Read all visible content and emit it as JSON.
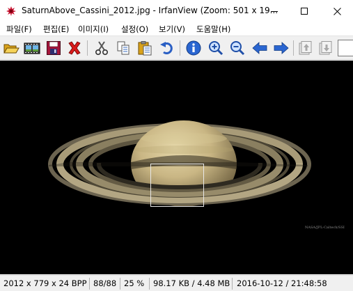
{
  "window": {
    "title": "SaturnAbove_Cassini_2012.jpg - IrfanView (Zoom: 501 x 19..."
  },
  "menu": [
    {
      "label": "파일(F)"
    },
    {
      "label": "편집(E)"
    },
    {
      "label": "이미지(I)"
    },
    {
      "label": "설정(O)"
    },
    {
      "label": "보기(V)"
    },
    {
      "label": "도움말(H)"
    }
  ],
  "toolbar": {
    "buttons": [
      "open-folder-icon",
      "slideshow-icon",
      "save-icon",
      "delete-icon",
      "cut-icon",
      "copy-icon",
      "paste-icon",
      "undo-icon",
      "info-icon",
      "zoom-in-icon",
      "zoom-out-icon",
      "previous-icon",
      "next-icon",
      "first-page-icon",
      "last-page-icon"
    ]
  },
  "image": {
    "credit": "NASA/JPL-Caltech/SSI"
  },
  "status": {
    "dimensions": "2012 x 779 x 24 BPP",
    "index": "88/88",
    "zoom": "25 %",
    "filesize": "98.17 KB / 4.48 MB",
    "datetime": "2016-10-12 / 21:48:58"
  }
}
